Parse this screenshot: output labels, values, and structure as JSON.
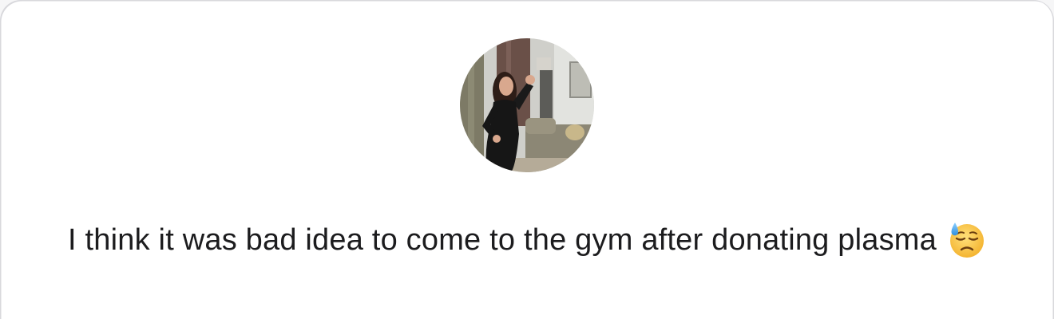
{
  "profile": {
    "avatar_icon": "profile-photo-woman-black-dress"
  },
  "message": {
    "text": "I think it was bad idea to come to the gym after donating plasma",
    "emoji_icon": "downcast-face-with-sweat-icon"
  },
  "colors": {
    "background": "#ffffff",
    "text": "#1c1c1e",
    "card_border": "#d8d8dc",
    "emoji_face": "#f7c44a"
  }
}
